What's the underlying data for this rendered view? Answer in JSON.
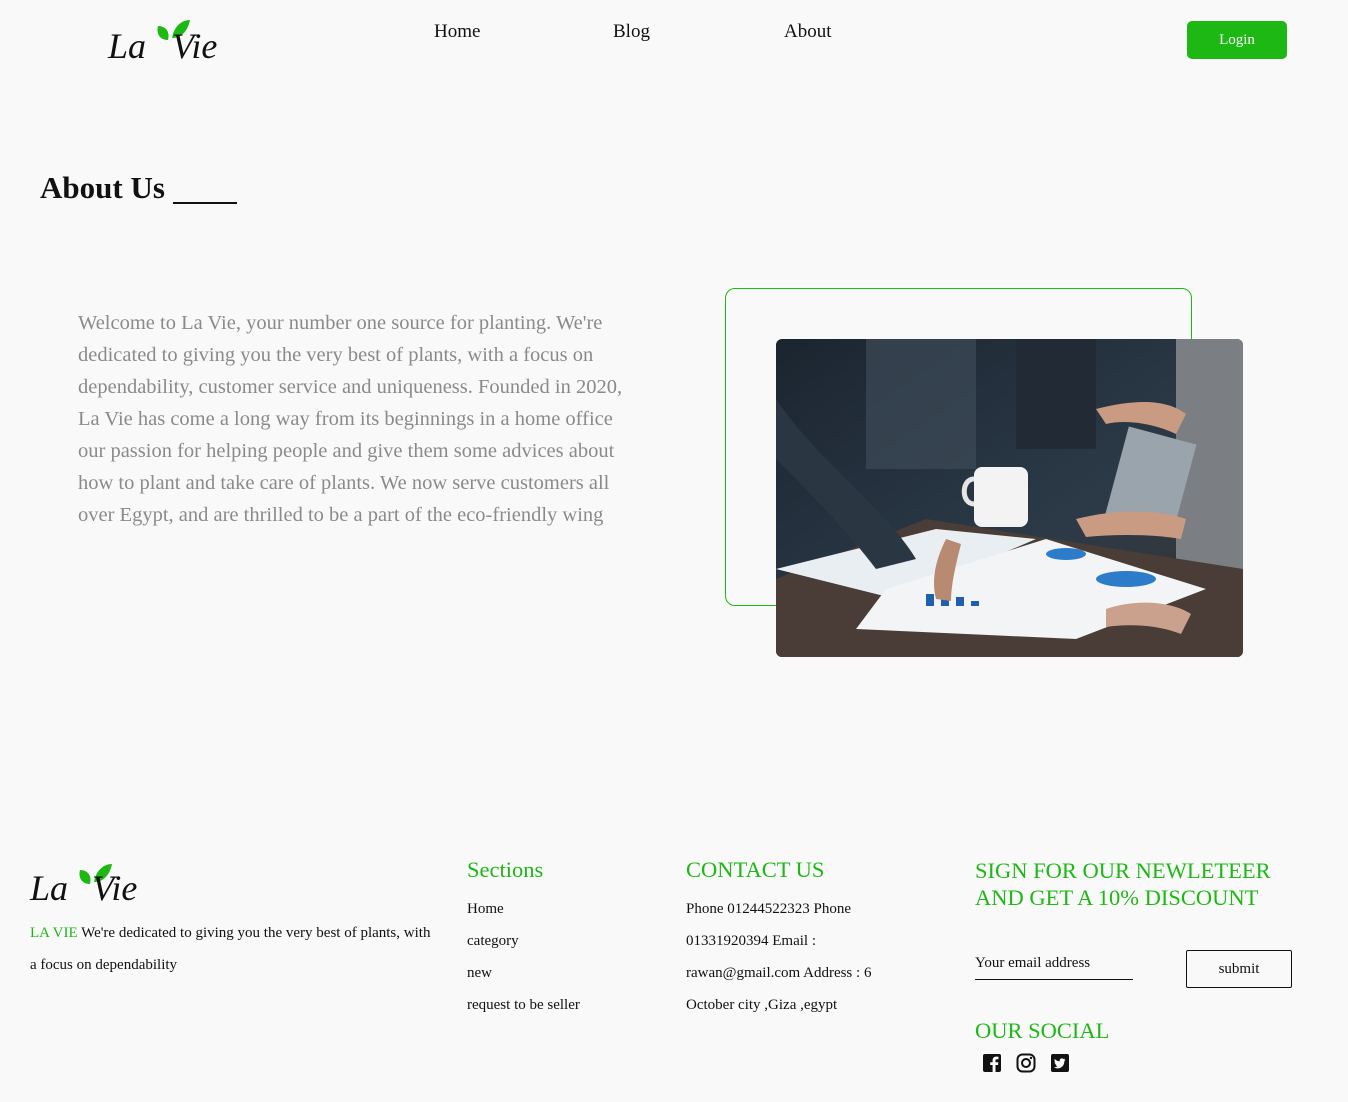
{
  "brand": {
    "logo_text": "La Vie",
    "accent_color": "#1db814"
  },
  "nav": {
    "items": [
      "Home",
      "Blog",
      "About"
    ],
    "login_label": "Login"
  },
  "about": {
    "title": "About Us",
    "text": "Welcome to La Vie, your number one source for planting. We're dedicated to giving you the very best of plants, with a focus on dependability, customer service and uniqueness. Founded in 2020, La Vie has come a long way from its beginnings in a home office our passion for helping people and give them some advices about how to plant and take care of plants. We now serve customers all over Egypt, and are thrilled to be a part of the eco-friendly wing",
    "image_icon": "team-meeting-photo"
  },
  "footer": {
    "brand_name": "LA VIE",
    "description": " We're dedicated to giving you the very best of plants, with a focus on dependability",
    "sections": {
      "title": "Sections",
      "items": [
        "Home",
        "category",
        "new",
        "request to be seller"
      ]
    },
    "contact": {
      "title": "CONTACT US",
      "text": "Phone 01244522323 Phone 01331920394 Email : rawan@gmail.com Address : 6 October city ,Giza ,egypt"
    },
    "newsletter": {
      "title": "SIGN FOR OUR NEWLETEER AND GET A 10% DISCOUNT",
      "placeholder": "Your email address",
      "submit_label": "submit"
    },
    "social": {
      "title": "OUR SOCIAL",
      "icons": [
        "facebook-icon",
        "instagram-icon",
        "twitter-icon"
      ]
    }
  }
}
